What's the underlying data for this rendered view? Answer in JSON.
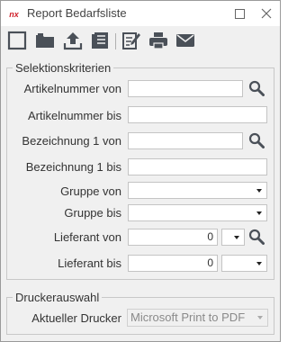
{
  "window": {
    "title": "Report Bedarfsliste",
    "logo_text": "nx"
  },
  "toolbar": {
    "icons": [
      "new-icon",
      "open-folder-icon",
      "upload-icon",
      "list-icon",
      "edit-icon",
      "print-icon",
      "mail-icon"
    ]
  },
  "criteria": {
    "legend": "Selektionskriterien",
    "artikel_von_label": "Artikelnummer von",
    "artikel_von_value": "",
    "artikel_bis_label": "Artikelnummer bis",
    "artikel_bis_value": "",
    "bez_von_label": "Bezeichnung 1 von",
    "bez_von_value": "",
    "bez_bis_label": "Bezeichnung 1 bis",
    "bez_bis_value": "",
    "gruppe_von_label": "Gruppe von",
    "gruppe_von_value": "",
    "gruppe_bis_label": "Gruppe bis",
    "gruppe_bis_value": "",
    "lief_von_label": "Lieferant von",
    "lief_von_value": "0",
    "lief_bis_label": "Lieferant bis",
    "lief_bis_value": "0"
  },
  "printer": {
    "legend": "Druckerauswahl",
    "label": "Aktueller Drucker",
    "value": "Microsoft Print to PDF"
  },
  "colors": {
    "accent": "#4a5058",
    "logo_red": "#d0202a"
  }
}
